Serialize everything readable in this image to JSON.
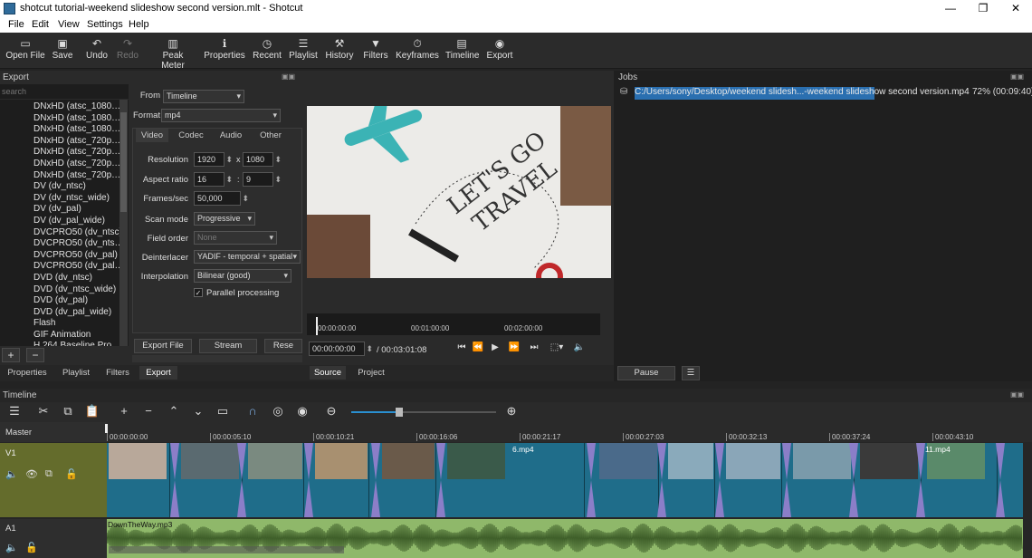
{
  "window": {
    "title": "shotcut tutorial-weekend slideshow second version.mlt - Shotcut",
    "minimize": "—",
    "maximize": "❐",
    "close": "✕"
  },
  "menu": [
    "File",
    "Edit",
    "View",
    "Settings",
    "Help"
  ],
  "toolbar": [
    {
      "label": "Open File",
      "icon": "folder-icon",
      "glyph": "▭"
    },
    {
      "label": "Save",
      "icon": "save-icon",
      "glyph": "▣"
    },
    {
      "label": "Undo",
      "icon": "undo-icon",
      "glyph": "↶"
    },
    {
      "label": "Redo",
      "icon": "redo-icon",
      "glyph": "↷"
    },
    {
      "label": "Peak Meter",
      "icon": "peak-meter-icon",
      "glyph": "▥"
    },
    {
      "label": "Properties",
      "icon": "info-icon",
      "glyph": "ℹ"
    },
    {
      "label": "Recent",
      "icon": "clock-icon",
      "glyph": "◷"
    },
    {
      "label": "Playlist",
      "icon": "list-icon",
      "glyph": "☰"
    },
    {
      "label": "History",
      "icon": "history-icon",
      "glyph": "⚒"
    },
    {
      "label": "Filters",
      "icon": "filter-icon",
      "glyph": "▼"
    },
    {
      "label": "Keyframes",
      "icon": "stopwatch-icon",
      "glyph": "⏱"
    },
    {
      "label": "Timeline",
      "icon": "timeline-icon",
      "glyph": "▤"
    },
    {
      "label": "Export",
      "icon": "export-icon",
      "glyph": "◉"
    }
  ],
  "export": {
    "title": "Export",
    "search_placeholder": "search",
    "presets": [
      "DNxHD (atsc_1080…",
      "DNxHD (atsc_1080…",
      "DNxHD (atsc_1080…",
      "DNxHD (atsc_720p…",
      "DNxHD (atsc_720p…",
      "DNxHD (atsc_720p…",
      "DNxHD (atsc_720p…",
      "DV (dv_ntsc)",
      "DV (dv_ntsc_wide)",
      "DV (dv_pal)",
      "DV (dv_pal_wide)",
      "DVCPRO50 (dv_ntsc)",
      "DVCPRO50 (dv_nts…",
      "DVCPRO50 (dv_pal)",
      "DVCPRO50 (dv_pal…",
      "DVD (dv_ntsc)",
      "DVD (dv_ntsc_wide)",
      "DVD (dv_pal)",
      "DVD (dv_pal_wide)",
      "Flash",
      "GIF Animation",
      "H.264 Baseline Pro…"
    ],
    "from_label": "From",
    "from_value": "Timeline",
    "format_label": "Format",
    "format_value": "mp4",
    "tabs": [
      "Video",
      "Codec",
      "Audio",
      "Other"
    ],
    "resolution_label": "Resolution",
    "res_w": "1920",
    "res_x": "x",
    "res_h": "1080",
    "aspect_label": "Aspect ratio",
    "aspect_w": "16",
    "aspect_sep": ":",
    "aspect_h": "9",
    "fps_label": "Frames/sec",
    "fps": "50,000",
    "scan_label": "Scan mode",
    "scan": "Progressive",
    "field_label": "Field order",
    "field": "None",
    "deint_label": "Deinterlacer",
    "deint": "YADIF - temporal + spatial",
    "interp_label": "Interpolation",
    "interp": "Bilinear (good)",
    "parallel_label": "Parallel processing",
    "parallel_check": "✓",
    "export_file": "Export File",
    "stream": "Stream",
    "reset": "Rese",
    "add": "+",
    "remove": "−",
    "bottom_tabs": [
      "Properties",
      "Playlist",
      "Filters",
      "Export"
    ]
  },
  "viewer": {
    "poster_text": "LET'S GO TRAVEL",
    "ruler": [
      "00:00:00:00",
      "00:01:00:00",
      "00:02:00:00"
    ],
    "position": "00:00:00:00",
    "duration": "/ 00:03:01:08",
    "transport": [
      "⏮",
      "⏪",
      "▶",
      "⏩",
      "⏭",
      "⬚▾",
      "🔈"
    ],
    "tabs": [
      "Source",
      "Project"
    ]
  },
  "jobs": {
    "title": "Jobs",
    "job_path": "C:/Users/sony/Desktop/weekend slidesh...-weekend slideshow second version.mp4",
    "job_status": "72% (00:09:40)",
    "pause": "Pause",
    "menu": "☰"
  },
  "timeline": {
    "title": "Timeline",
    "tools": [
      "☰",
      "✂",
      "⧉",
      "📋",
      "+",
      "−",
      "⌃",
      "⌄",
      "▭",
      "∩",
      "◎",
      "◉",
      "⊖",
      "⊕"
    ],
    "zoom_fraction": 0.33,
    "master": "Master",
    "ruler": [
      "00:00:00:00",
      "00:00:05:10",
      "00:00:10:21",
      "00:00:16:06",
      "00:00:21:17",
      "00:00:27:03",
      "00:00:32:13",
      "00:00:37:24",
      "00:00:43:10"
    ],
    "v1": "V1",
    "a1": "A1",
    "clip_labels": [
      "6.mp4",
      "11.mp4"
    ],
    "audio_clip": "DownTheWay.mp3"
  },
  "colors": {
    "accent": "#1f6d8a",
    "track_header": "#646c2c",
    "transition": "#8b7ec8",
    "audio": "#8fb86a",
    "selection": "#2a6fb0"
  }
}
